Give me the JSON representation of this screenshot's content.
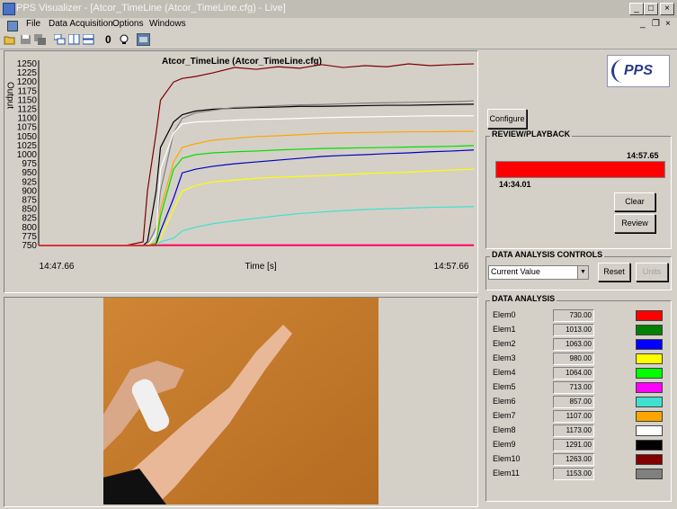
{
  "window": {
    "title": "PPS Visualizer - [Atcor_TimeLine (Atcor_TimeLine.cfg) - Live]",
    "controls": {
      "minimize": "_",
      "maximize": "□",
      "close": "×"
    },
    "mdi_controls": {
      "minimize": "_",
      "restore": "❐",
      "close": "×"
    }
  },
  "menu": {
    "items": [
      "File",
      "Data Acquisition",
      "Options",
      "Windows"
    ]
  },
  "toolbar": {
    "icons": [
      "open-folder-icon",
      "save-icon",
      "save-all-icon",
      "cascade-windows-icon",
      "tile-vertical-icon",
      "tile-horizontal-icon",
      "zero-icon",
      "lightbulb-icon",
      "record-icon"
    ],
    "zero_label": "0"
  },
  "chart_data": {
    "type": "line",
    "title": "Atcor_TimeLine (Atcor_TimeLine.cfg)",
    "ylabel": "Output",
    "xlabel": "Time [s]",
    "x_tick_labels": [
      "14:47.66",
      "14:57.66"
    ],
    "ylim": [
      750,
      1250
    ],
    "y_ticks": [
      1250,
      1225,
      1200,
      1175,
      1150,
      1125,
      1100,
      1075,
      1050,
      1025,
      1000,
      975,
      950,
      925,
      900,
      875,
      850,
      825,
      800,
      775,
      750
    ],
    "grid": false,
    "x": [
      0,
      20,
      24,
      25,
      27,
      28,
      31,
      33,
      36,
      40,
      45,
      50,
      55,
      60,
      65,
      70,
      75,
      80,
      85,
      90,
      95,
      100
    ],
    "series": [
      {
        "color": "#800000",
        "values": [
          750,
          750,
          760,
          900,
          1060,
          1150,
          1200,
          1210,
          1215,
          1225,
          1240,
          1235,
          1242,
          1238,
          1248,
          1240,
          1245,
          1242,
          1250,
          1245,
          1248,
          1250
        ]
      },
      {
        "color": "#000000",
        "values": [
          750,
          750,
          750,
          760,
          900,
          1020,
          1090,
          1110,
          1120,
          1125,
          1128,
          1130,
          1131,
          1133,
          1133,
          1134,
          1135,
          1136,
          1136,
          1137,
          1138,
          1139
        ]
      },
      {
        "color": "#808080",
        "values": [
          750,
          750,
          750,
          750,
          800,
          900,
          1060,
          1100,
          1115,
          1122,
          1130,
          1132,
          1135,
          1137,
          1138,
          1140,
          1142,
          1143,
          1144,
          1145,
          1146,
          1148
        ]
      },
      {
        "color": "#ffffff",
        "values": [
          750,
          750,
          750,
          750,
          780,
          960,
          1060,
          1085,
          1090,
          1092,
          1095,
          1097,
          1098,
          1100,
          1102,
          1103,
          1104,
          1105,
          1106,
          1107,
          1107,
          1107
        ]
      },
      {
        "color": "#ffa500",
        "values": [
          750,
          750,
          750,
          750,
          760,
          850,
          980,
          1020,
          1030,
          1040,
          1045,
          1050,
          1052,
          1055,
          1058,
          1060,
          1061,
          1062,
          1063,
          1063,
          1064,
          1064
        ]
      },
      {
        "color": "#00e000",
        "values": [
          750,
          750,
          750,
          750,
          755,
          830,
          960,
          990,
          1000,
          1005,
          1008,
          1010,
          1013,
          1015,
          1017,
          1018,
          1019,
          1020,
          1021,
          1022,
          1023,
          1025
        ]
      },
      {
        "color": "#0000c0",
        "values": [
          750,
          750,
          750,
          750,
          752,
          790,
          880,
          950,
          960,
          968,
          975,
          980,
          985,
          990,
          995,
          998,
          1000,
          1003,
          1005,
          1008,
          1010,
          1013
        ]
      },
      {
        "color": "#ffff00",
        "values": [
          750,
          750,
          750,
          750,
          750,
          770,
          850,
          900,
          915,
          925,
          930,
          935,
          938,
          940,
          942,
          945,
          948,
          950,
          952,
          955,
          958,
          960
        ]
      },
      {
        "color": "#40e0d0",
        "values": [
          750,
          750,
          750,
          750,
          750,
          760,
          770,
          790,
          800,
          810,
          818,
          825,
          832,
          838,
          842,
          846,
          849,
          851,
          853,
          855,
          856,
          857
        ]
      },
      {
        "color": "#ff00ff",
        "values": [
          750,
          750,
          750,
          750,
          750,
          752,
          752,
          752,
          752,
          752,
          752,
          752,
          752,
          752,
          752,
          752,
          752,
          752,
          752,
          752,
          752,
          752
        ]
      },
      {
        "color": "#ff0000",
        "values": [
          750,
          750,
          750,
          750,
          750,
          750,
          750,
          750,
          750,
          750,
          750,
          750,
          750,
          750,
          750,
          750,
          750,
          750,
          750,
          750,
          750,
          750
        ]
      }
    ]
  },
  "logo": {
    "text": "PPS"
  },
  "configure_button": "Configure",
  "review": {
    "title": "REVIEW/PLAYBACK",
    "end_time": "14:57.65",
    "start_time": "14:34.01",
    "bar_color": "#ff0000",
    "progress": 1.0,
    "clear_button": "Clear",
    "review_button": "Review"
  },
  "controls": {
    "title": "DATA ANALYSIS CONTROLS",
    "select_value": "Current Value",
    "reset_button": "Reset",
    "units_button": "Units"
  },
  "analysis": {
    "title": "DATA ANALYSIS",
    "elements": [
      {
        "name": "Elem0",
        "value": "730.00",
        "color": "#ff0000"
      },
      {
        "name": "Elem1",
        "value": "1013.00",
        "color": "#008000"
      },
      {
        "name": "Elem2",
        "value": "1063.00",
        "color": "#0000ff"
      },
      {
        "name": "Elem3",
        "value": "980.00",
        "color": "#ffff00"
      },
      {
        "name": "Elem4",
        "value": "1064.00",
        "color": "#00ff00"
      },
      {
        "name": "Elem5",
        "value": "713.00",
        "color": "#ff00ff"
      },
      {
        "name": "Elem6",
        "value": "857.00",
        "color": "#40e0d0"
      },
      {
        "name": "Elem7",
        "value": "1107.00",
        "color": "#ffa500"
      },
      {
        "name": "Elem8",
        "value": "1173.00",
        "color": "#ffffff"
      },
      {
        "name": "Elem9",
        "value": "1291.00",
        "color": "#000000"
      },
      {
        "name": "Elem10",
        "value": "1263.00",
        "color": "#800000"
      },
      {
        "name": "Elem11",
        "value": "1153.00",
        "color": "#808080"
      }
    ]
  }
}
